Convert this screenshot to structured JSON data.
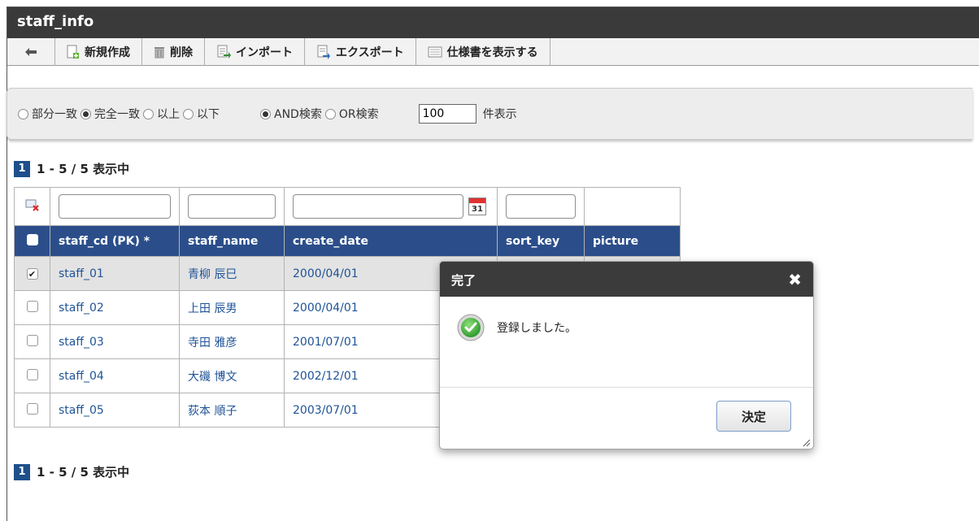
{
  "window": {
    "title": "staff_info"
  },
  "toolbar": {
    "new_label": "新規作成",
    "delete_label": "削除",
    "import_label": "インポート",
    "export_label": "エクスポート",
    "spec_label": "仕様書を表示する"
  },
  "search": {
    "match_options": [
      "部分一致",
      "完全一致",
      "以上",
      "以下"
    ],
    "match_selected": "完全一致",
    "logic_options": [
      "AND検索",
      "OR検索"
    ],
    "logic_selected": "AND検索",
    "count_value": "100",
    "count_suffix": "件表示"
  },
  "pager": {
    "page": "1",
    "summary": "1 - 5 / 5 表示中"
  },
  "table": {
    "columns": [
      "staff_cd (PK) *",
      "staff_name",
      "create_date",
      "sort_key",
      "picture"
    ],
    "rows": [
      {
        "staff_cd": "staff_01",
        "staff_name": "青柳 辰巳",
        "create_date": "2000/04/01",
        "checked": true
      },
      {
        "staff_cd": "staff_02",
        "staff_name": "上田 辰男",
        "create_date": "2000/04/01",
        "checked": false
      },
      {
        "staff_cd": "staff_03",
        "staff_name": "寺田 雅彦",
        "create_date": "2001/07/01",
        "checked": false
      },
      {
        "staff_cd": "staff_04",
        "staff_name": "大磯 博文",
        "create_date": "2002/12/01",
        "checked": false
      },
      {
        "staff_cd": "staff_05",
        "staff_name": "荻本 順子",
        "create_date": "2003/07/01",
        "checked": false
      }
    ]
  },
  "calendar_icon_day": "31",
  "dialog": {
    "title": "完了",
    "close_symbol": "✖",
    "message": "登録しました。",
    "ok_label": "決定"
  },
  "colors": {
    "title_bar": "#3a3a3a",
    "table_header": "#2b4e8a",
    "link_text": "#1f5396",
    "pager_badge": "#1f4f8b"
  },
  "icons": [
    "back-arrow-icon",
    "new-document-icon",
    "trash-icon",
    "import-icon",
    "export-icon",
    "spec-document-icon",
    "clear-filter-icon",
    "calendar-icon",
    "success-check-icon",
    "resize-grip-icon"
  ]
}
